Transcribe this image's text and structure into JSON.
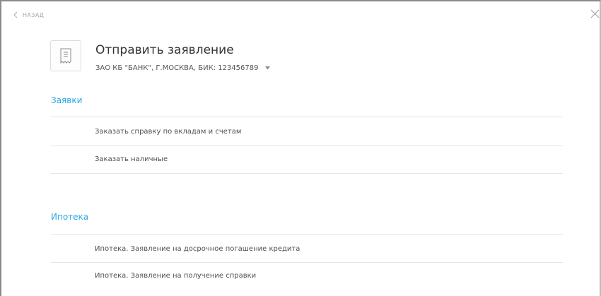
{
  "nav": {
    "back_label": "НАЗАД",
    "back_icon": "chevron-left-icon",
    "close_icon": "close-icon"
  },
  "header": {
    "icon": "receipt-document-icon",
    "title": "Отправить заявление",
    "account": {
      "selected": "ЗАО КБ \"БАНК\", Г.МОСКВА, БИК: 123456789",
      "dropdown_icon": "caret-down-icon"
    }
  },
  "sections": [
    {
      "title": "Заявки",
      "items": [
        {
          "label": "Заказать справку по вкладам и счетам"
        },
        {
          "label": "Заказать наличные"
        }
      ]
    },
    {
      "title": "Ипотека",
      "items": [
        {
          "label": "Ипотека. Заявление на досрочное погашение кредита"
        },
        {
          "label": "Ипотека. Заявление на получение справки"
        }
      ]
    }
  ],
  "colors": {
    "accent": "#29abe2",
    "text": "#444444",
    "muted": "#a9a9a9",
    "divider": "#e4e4e4",
    "frame": "#8a8a8a"
  }
}
